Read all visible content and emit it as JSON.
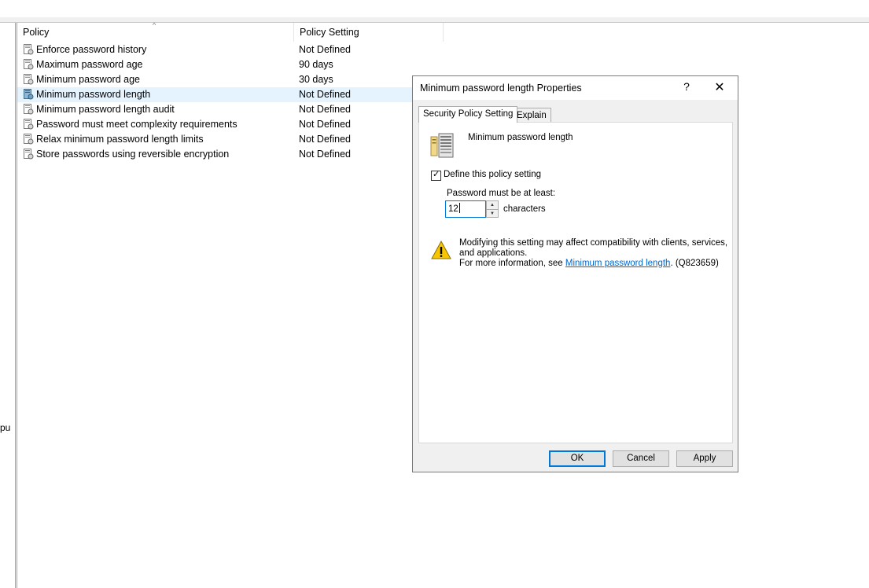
{
  "tree": {
    "cut_label": "pu"
  },
  "list": {
    "headers": {
      "policy": "Policy",
      "setting": "Policy Setting"
    },
    "rows": [
      {
        "name": "Enforce password history",
        "value": "Not Defined"
      },
      {
        "name": "Maximum password age",
        "value": "90 days"
      },
      {
        "name": "Minimum password age",
        "value": "30 days"
      },
      {
        "name": "Minimum password length",
        "value": "Not Defined"
      },
      {
        "name": "Minimum password length audit",
        "value": "Not Defined"
      },
      {
        "name": "Password must meet complexity requirements",
        "value": "Not Defined"
      },
      {
        "name": "Relax minimum password length limits",
        "value": "Not Defined"
      },
      {
        "name": "Store passwords using reversible encryption",
        "value": "Not Defined"
      }
    ],
    "selected_index": 3
  },
  "dialog": {
    "title": "Minimum password length Properties",
    "help_glyph": "?",
    "close_glyph": "✕",
    "tabs": [
      "Security Policy Setting",
      "Explain"
    ],
    "policy_title": "Minimum password length",
    "define_label": "Define this policy setting",
    "define_checked": true,
    "min_label": "Password must be at least:",
    "min_value": "12",
    "unit": "characters",
    "warning_line1": "Modifying this setting may affect compatibility with clients, services,",
    "warning_line2": "and applications.",
    "warning_prefix": "For more information, see ",
    "warning_link": "Minimum password length",
    "warning_suffix": ". (Q823659)",
    "buttons": {
      "ok": "OK",
      "cancel": "Cancel",
      "apply": "Apply"
    }
  },
  "colors": {
    "accent": "#0078d7",
    "selection": "#e5f3ff",
    "link": "#0066cc"
  },
  "icons": {
    "row": "policy-doc-icon",
    "server": "server-icon",
    "warning": "warning-icon"
  }
}
